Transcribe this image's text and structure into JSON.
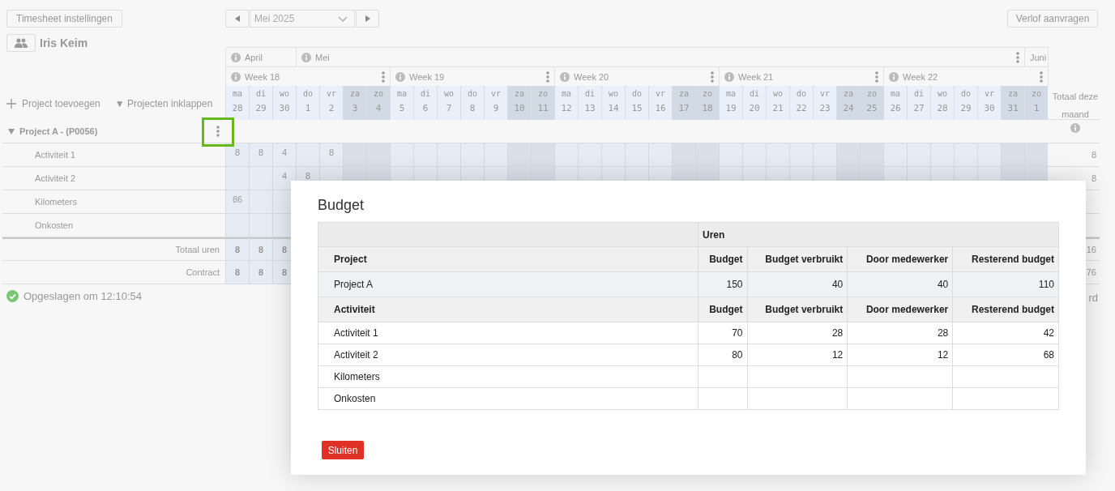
{
  "toolbar": {
    "settings_button": "Timesheet instellingen",
    "month_select": "Mei 2025",
    "leave_button": "Verlof aanvragen"
  },
  "employee": {
    "name": "Iris Keim"
  },
  "actions": {
    "add_project": "Project toevoegen",
    "collapse_projects": "Projecten inklappen",
    "collapse_icon": "▼"
  },
  "months": [
    {
      "label": "April",
      "info": true,
      "menu": false,
      "days": [
        {
          "dow": "ma",
          "date": "28",
          "weekend": false
        },
        {
          "dow": "di",
          "date": "29",
          "weekend": false
        },
        {
          "dow": "wo",
          "date": "30",
          "weekend": false
        }
      ]
    },
    {
      "label": "Mei",
      "info": true,
      "menu": true,
      "days": [
        {
          "dow": "do",
          "date": "1",
          "weekend": false
        },
        {
          "dow": "vr",
          "date": "2",
          "weekend": false
        },
        {
          "dow": "za",
          "date": "3",
          "weekend": true
        },
        {
          "dow": "zo",
          "date": "4",
          "weekend": true
        },
        {
          "dow": "ma",
          "date": "5",
          "weekend": false
        },
        {
          "dow": "di",
          "date": "6",
          "weekend": false
        },
        {
          "dow": "wo",
          "date": "7",
          "weekend": false
        },
        {
          "dow": "do",
          "date": "8",
          "weekend": false
        },
        {
          "dow": "vr",
          "date": "9",
          "weekend": false
        },
        {
          "dow": "za",
          "date": "10",
          "weekend": true
        },
        {
          "dow": "zo",
          "date": "11",
          "weekend": true
        },
        {
          "dow": "ma",
          "date": "12",
          "weekend": false
        },
        {
          "dow": "di",
          "date": "13",
          "weekend": false
        },
        {
          "dow": "wo",
          "date": "14",
          "weekend": false
        },
        {
          "dow": "do",
          "date": "15",
          "weekend": false
        },
        {
          "dow": "vr",
          "date": "16",
          "weekend": false
        },
        {
          "dow": "za",
          "date": "17",
          "weekend": true
        },
        {
          "dow": "zo",
          "date": "18",
          "weekend": true
        },
        {
          "dow": "ma",
          "date": "19",
          "weekend": false
        },
        {
          "dow": "di",
          "date": "20",
          "weekend": false
        },
        {
          "dow": "wo",
          "date": "21",
          "weekend": false
        },
        {
          "dow": "do",
          "date": "22",
          "weekend": false
        },
        {
          "dow": "vr",
          "date": "23",
          "weekend": false
        },
        {
          "dow": "za",
          "date": "24",
          "weekend": true
        },
        {
          "dow": "zo",
          "date": "25",
          "weekend": true
        },
        {
          "dow": "ma",
          "date": "26",
          "weekend": false
        },
        {
          "dow": "di",
          "date": "27",
          "weekend": false
        },
        {
          "dow": "wo",
          "date": "28",
          "weekend": false
        },
        {
          "dow": "do",
          "date": "29",
          "weekend": false
        },
        {
          "dow": "vr",
          "date": "30",
          "weekend": false
        },
        {
          "dow": "za",
          "date": "31",
          "weekend": true
        }
      ]
    },
    {
      "label": "Juni",
      "info": false,
      "menu": false,
      "days": [
        {
          "dow": "zo",
          "date": "1",
          "weekend": true
        }
      ]
    }
  ],
  "weeks": [
    {
      "label": "Week 18"
    },
    {
      "label": "Week 19"
    },
    {
      "label": "Week 20"
    },
    {
      "label": "Week 21"
    },
    {
      "label": "Week 22"
    }
  ],
  "total_header": "Totaal deze maand",
  "project": {
    "label": "Project A - (P0056)",
    "expanded": true
  },
  "activities": [
    {
      "name": "Activiteit 1",
      "hours": [
        {
          "kind": "hours",
          "value": "8"
        },
        {
          "kind": "hours",
          "value": "8"
        },
        {
          "kind": "hours",
          "value": "4"
        },
        {
          "kind": "empty"
        },
        {
          "kind": "hours",
          "value": "8"
        }
      ],
      "total": "8"
    },
    {
      "name": "Activiteit 2",
      "hours": [
        {
          "kind": "empty"
        },
        {
          "kind": "empty"
        },
        {
          "kind": "hours",
          "value": "4"
        },
        {
          "kind": "hours",
          "value": "8"
        }
      ],
      "total": "8"
    },
    {
      "name": "Kilometers",
      "hours": [
        {
          "kind": "hours",
          "value": "86"
        }
      ]
    },
    {
      "name": "Onkosten"
    }
  ],
  "summary": [
    {
      "label": "Totaal uren",
      "hours": [
        {
          "kind": "hours",
          "value": "8"
        },
        {
          "kind": "hours",
          "value": "8"
        },
        {
          "kind": "hours",
          "value": "8"
        }
      ],
      "total": "16"
    },
    {
      "label": "Contract",
      "hours": [
        {
          "kind": "hours",
          "value": "8"
        },
        {
          "kind": "hours",
          "value": "8"
        },
        {
          "kind": "hours",
          "value": "8"
        }
      ],
      "total": "76"
    }
  ],
  "status": {
    "saved": "Opgeslagen om 12:10:54",
    "right_fragment": "rd"
  },
  "dialog": {
    "title": "Budget",
    "group_header": "Uren",
    "sections": [
      {
        "kind": "project",
        "header": [
          "Project",
          "Budget",
          "Budget verbruikt",
          "Door medewerker",
          "Resterend budget"
        ],
        "rows": [
          [
            "Project A",
            "150",
            "40",
            "40",
            "110"
          ]
        ]
      },
      {
        "kind": "activity",
        "header": [
          "Activiteit",
          "Budget",
          "Budget verbruikt",
          "Door medewerker",
          "Resterend budget"
        ],
        "rows": [
          [
            "Activiteit 1",
            "70",
            "28",
            "28",
            "42"
          ],
          [
            "Activiteit 2",
            "80",
            "12",
            "12",
            "68"
          ],
          [
            "Kilometers"
          ],
          [
            "Onkosten"
          ]
        ]
      }
    ],
    "close_button": "Sluiten"
  }
}
